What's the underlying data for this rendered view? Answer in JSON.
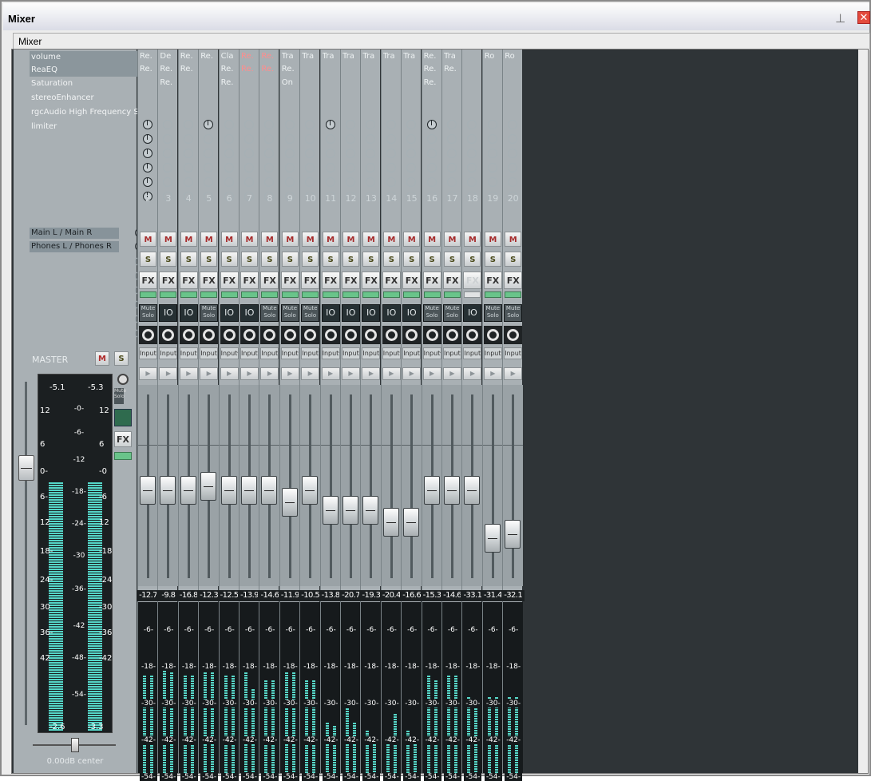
{
  "window": {
    "title": "Mixer",
    "tab": "Mixer",
    "pin_icon": "pin-icon",
    "close_label": "✕"
  },
  "fx_list": [
    "volume",
    "ReaEQ",
    "Saturation",
    "stereoEnhancer",
    "rgcAudio High Frequency S",
    "limiter"
  ],
  "sends": [
    "Main L / Main R",
    "Phones L / Phones R"
  ],
  "master": {
    "label": "MASTER",
    "mute": "M",
    "solo": "S",
    "peak_l": "-5.1",
    "peak_r": "-5.3",
    "rms_l": "-2.6",
    "rms_r": "-3.3",
    "zero": "-0-",
    "fx": "FX",
    "pan_label": "0.00dB center",
    "level_fraction": 0.74,
    "scale_left": [
      "12",
      "6",
      "0-",
      "6-",
      "12",
      "18-",
      "24-",
      "30",
      "36-",
      "42"
    ],
    "scale_mid": [
      "-6-",
      "-12",
      "-18-",
      "-24-",
      "-30",
      "-36-",
      "-42",
      "-48-",
      "-54-"
    ],
    "scale_right": [
      "12",
      "6",
      "-0",
      "-6",
      "12",
      "-18",
      "-24",
      "-30",
      "-36",
      "-42"
    ]
  },
  "tracks": [
    {
      "num": "2",
      "name": "Re.",
      "fx": [
        "Re."
      ],
      "knobs": [
        1,
        1,
        1,
        1,
        1,
        1
      ],
      "db": "-12.7",
      "fader": 0.72,
      "lv": [
        0.58,
        0.58
      ],
      "io": "grid",
      "fxon": true
    },
    {
      "num": "3",
      "name": "De",
      "fx": [
        "Re.",
        "Re."
      ],
      "knobs": [
        0,
        0,
        0,
        0,
        0,
        0
      ],
      "db": "-9.8",
      "fader": 0.72,
      "lv": [
        0.65,
        0.6
      ],
      "io": "IO",
      "fxon": true
    },
    {
      "num": "4",
      "name": "Re.",
      "fx": [
        "Re."
      ],
      "knobs": [
        0,
        0,
        0,
        0,
        0,
        0
      ],
      "db": "-16.8",
      "fader": 0.72,
      "lv": [
        0.58,
        0.58
      ],
      "io": "IO",
      "fxon": true
    },
    {
      "num": "5",
      "name": "Re.",
      "fx": [],
      "knobs": [
        1,
        0,
        0,
        0,
        0,
        0
      ],
      "db": "-12.3",
      "fader": 0.73,
      "lv": [
        0.6,
        0.6
      ],
      "io": "grid",
      "fxon": true
    },
    {
      "num": "6",
      "name": "Cla",
      "fx": [
        "Re.",
        "Re."
      ],
      "knobs": [
        0,
        0,
        0,
        0,
        0,
        0
      ],
      "db": "-12.5",
      "fader": 0.72,
      "lv": [
        0.58,
        0.58
      ],
      "io": "IO",
      "fxon": true
    },
    {
      "num": "7",
      "name": "Re.",
      "fx": [
        "Re."
      ],
      "knobs": [
        0,
        0,
        0,
        0,
        0,
        0
      ],
      "db": "-13.9",
      "fader": 0.72,
      "lv": [
        0.6,
        0.5
      ],
      "io": "IO",
      "fxon": true,
      "nameoff": true,
      "fxoff": true
    },
    {
      "num": "8",
      "name": "Re.",
      "fx": [
        "Re."
      ],
      "knobs": [
        0,
        0,
        0,
        0,
        0,
        0
      ],
      "db": "-14.6",
      "fader": 0.72,
      "lv": [
        0.55,
        0.55
      ],
      "io": "grid",
      "fxon": true,
      "nameoff": true,
      "fxoff": true
    },
    {
      "num": "9",
      "name": "Tra",
      "fx": [
        "Re.",
        "On"
      ],
      "knobs": [
        0,
        0,
        0,
        0,
        0,
        0
      ],
      "db": "-11.9",
      "fader": 0.69,
      "lv": [
        0.6,
        0.6
      ],
      "io": "grid",
      "fxon": true
    },
    {
      "num": "10",
      "name": "Tra",
      "fx": [],
      "knobs": [
        0,
        0,
        0,
        0,
        0,
        0
      ],
      "db": "-10.5",
      "fader": 0.72,
      "lv": [
        0.55,
        0.55
      ],
      "io": "grid",
      "fxon": true
    },
    {
      "num": "11",
      "name": "Tra",
      "fx": [],
      "knobs": [
        1,
        0,
        0,
        0,
        0,
        0
      ],
      "db": "-13.8",
      "fader": 0.67,
      "lv": [
        0.3,
        0.28
      ],
      "io": "IO",
      "fxon": true
    },
    {
      "num": "12",
      "name": "Tra",
      "fx": [],
      "knobs": [
        0,
        0,
        0,
        0,
        0,
        0
      ],
      "db": "-20.7",
      "fader": 0.67,
      "lv": [
        0.4,
        0.3
      ],
      "io": "IO",
      "fxon": true
    },
    {
      "num": "13",
      "name": "Tra",
      "fx": [],
      "knobs": [
        0,
        0,
        0,
        0,
        0,
        0
      ],
      "db": "-19.3",
      "fader": 0.67,
      "lv": [
        0.25,
        0.2
      ],
      "io": "IO",
      "fxon": true
    },
    {
      "num": "14",
      "name": "Tra",
      "fx": [],
      "knobs": [
        0,
        0,
        0,
        0,
        0,
        0
      ],
      "db": "-20.4",
      "fader": 0.64,
      "lv": [
        0.2,
        0.35
      ],
      "io": "IO",
      "fxon": true
    },
    {
      "num": "15",
      "name": "Tra",
      "fx": [],
      "knobs": [
        0,
        0,
        0,
        0,
        0,
        0
      ],
      "db": "-16.6",
      "fader": 0.64,
      "lv": [
        0.25,
        0.2
      ],
      "io": "IO",
      "fxon": true
    },
    {
      "num": "16",
      "name": "Re.",
      "fx": [
        "Re.",
        "Re."
      ],
      "knobs": [
        1,
        0,
        0,
        0,
        0,
        0
      ],
      "db": "-15.3",
      "fader": 0.72,
      "lv": [
        0.58,
        0.55
      ],
      "io": "grid",
      "fxon": true
    },
    {
      "num": "17",
      "name": "Tra",
      "fx": [
        "Re."
      ],
      "knobs": [
        0,
        0,
        0,
        0,
        0,
        0
      ],
      "db": "-14.6",
      "fader": 0.72,
      "lv": [
        0.58,
        0.58
      ],
      "io": "grid",
      "fxon": true
    },
    {
      "num": "18",
      "name": "",
      "fx": [],
      "knobs": [
        0,
        0,
        0,
        0,
        0,
        0
      ],
      "db": "-33.1",
      "fader": 0.72,
      "lv": [
        0.45,
        0.4
      ],
      "io": "IO",
      "fxon": false
    },
    {
      "num": "19",
      "name": "Ro",
      "fx": [],
      "knobs": [
        0,
        0,
        0,
        0,
        0,
        0
      ],
      "db": "-31.4",
      "fader": 0.6,
      "lv": [
        0.45,
        0.45
      ],
      "io": "grid",
      "fxon": true
    },
    {
      "num": "20",
      "name": "Ro",
      "fx": [],
      "knobs": [
        0,
        0,
        0,
        0,
        0,
        0
      ],
      "db": "-32.1",
      "fader": 0.61,
      "lv": [
        0.45,
        0.45
      ],
      "io": "grid",
      "fxon": true
    }
  ],
  "strip": {
    "mute": "M",
    "solo": "S",
    "fx": "FX",
    "io": "IO",
    "io_grid": "Mute Solo",
    "input": "Input▾",
    "play": "▶"
  },
  "meter_scale": [
    "-6-",
    "-18-",
    "-30-",
    "-42-",
    "-54-"
  ]
}
